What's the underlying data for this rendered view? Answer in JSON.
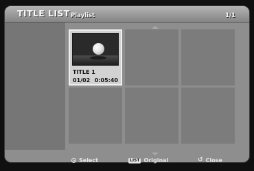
{
  "header": {
    "title": "TITLE LIST",
    "subtitle": "Playlist",
    "page_count": "1/1"
  },
  "grid": {
    "selected_item": {
      "title": "TITLE 1",
      "date": "01/02",
      "duration": "0:05:40"
    }
  },
  "footer": {
    "select": {
      "icon": "select-circle-icon",
      "label": "Select"
    },
    "original": {
      "key": "LIST",
      "label": "Original"
    },
    "close": {
      "icon": "return-icon",
      "label": "Close"
    }
  },
  "colors": {
    "background": "#101010",
    "panel": "#8e8e8e",
    "selected_cell": "#d2d2d2"
  }
}
